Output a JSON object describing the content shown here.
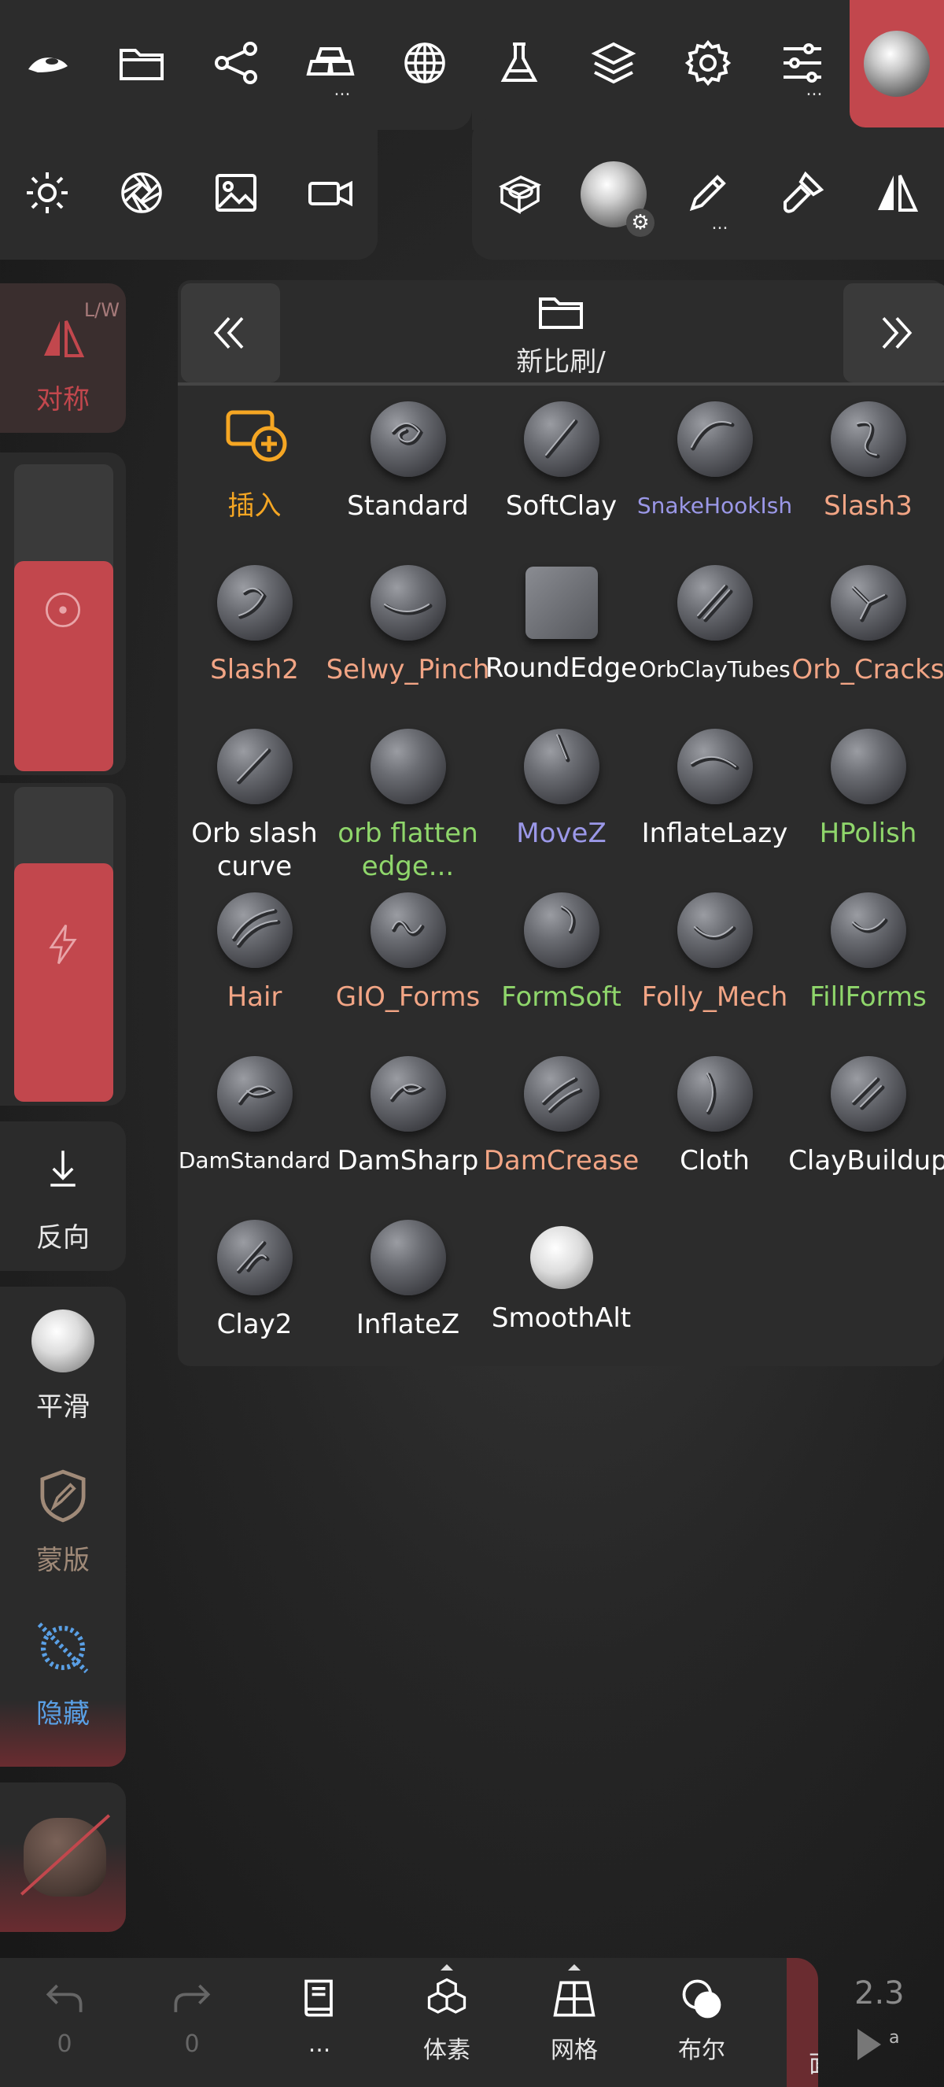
{
  "toolbar": {
    "row1": [
      "logo-icon",
      "folder-icon",
      "share-graph-icon",
      "gold-bars-icon",
      "sphere-mesh-icon",
      "flask-icon",
      "layers-icon",
      "gear-icon",
      "sliders-icon",
      "matcap-ball-icon"
    ],
    "row1_dots": {
      "gold-bars-icon": "...",
      "sliders-icon": "..."
    },
    "row2": [
      "sun-icon",
      "aperture-icon",
      "image-icon",
      "video-camera-icon"
    ],
    "row2_right": [
      "wireframe-box-icon",
      "material-ball-icon",
      "brush-pen-icon",
      "paint-brush-icon",
      "symmetry-icon"
    ],
    "row2_dots": {
      "brush-pen-icon": "..."
    }
  },
  "side": {
    "symmetry": {
      "badge": "L/W",
      "label": "对称"
    },
    "reverse": {
      "label": "反向"
    },
    "smooth": {
      "label": "平滑"
    },
    "mask": {
      "label": "蒙版"
    },
    "hide": {
      "label": "隐藏"
    }
  },
  "brush_panel": {
    "folder_title": "新比刷/",
    "brushes": [
      {
        "name": "插入",
        "color": "#f5a623",
        "icon": "insert-icon"
      },
      {
        "name": "Standard",
        "color": "#ffffff"
      },
      {
        "name": "SoftClay",
        "color": "#ffffff"
      },
      {
        "name": "SnakeHookIsh",
        "color": "#9b98e8"
      },
      {
        "name": "Slash3",
        "color": "#f2a585"
      },
      {
        "name": "Slash2",
        "color": "#f2a585"
      },
      {
        "name": "Selwy_Pinch",
        "color": "#f2a585"
      },
      {
        "name": "RoundEdge",
        "color": "#ffffff"
      },
      {
        "name": "OrbClayTubes",
        "color": "#ffffff"
      },
      {
        "name": "Orb_Cracks",
        "color": "#f2a585"
      },
      {
        "name": "Orb slash curve",
        "color": "#ffffff"
      },
      {
        "name": "orb flatten edge...",
        "color": "#8fd66b"
      },
      {
        "name": "MoveZ",
        "color": "#9b98e8"
      },
      {
        "name": "InflateLazy",
        "color": "#ffffff"
      },
      {
        "name": "HPolish",
        "color": "#8fd66b"
      },
      {
        "name": "Hair",
        "color": "#f2a585"
      },
      {
        "name": "GIO_Forms",
        "color": "#f2a585"
      },
      {
        "name": "FormSoft",
        "color": "#8fd66b"
      },
      {
        "name": "Folly_Mech",
        "color": "#f2a585"
      },
      {
        "name": "FillForms",
        "color": "#8fd66b"
      },
      {
        "name": "DamStandard",
        "color": "#ffffff"
      },
      {
        "name": "DamSharp",
        "color": "#ffffff"
      },
      {
        "name": "DamCrease",
        "color": "#f2a585"
      },
      {
        "name": "Cloth",
        "color": "#ffffff"
      },
      {
        "name": "ClayBuildup",
        "color": "#ffffff"
      },
      {
        "name": "Clay2",
        "color": "#ffffff"
      },
      {
        "name": "InflateZ",
        "color": "#ffffff"
      },
      {
        "name": "SmoothAlt",
        "color": "#ffffff"
      }
    ]
  },
  "bottom": {
    "undo_count": "0",
    "redo_count": "0",
    "book_label": "...",
    "voxel_label": "体素",
    "mesh_label": "网格",
    "boolean_label": "布尔",
    "version": "2.3",
    "edge_label": "面"
  },
  "colors": {
    "accent_red": "#c2474d",
    "panel": "#2c2c2c",
    "orange": "#f5a623"
  }
}
